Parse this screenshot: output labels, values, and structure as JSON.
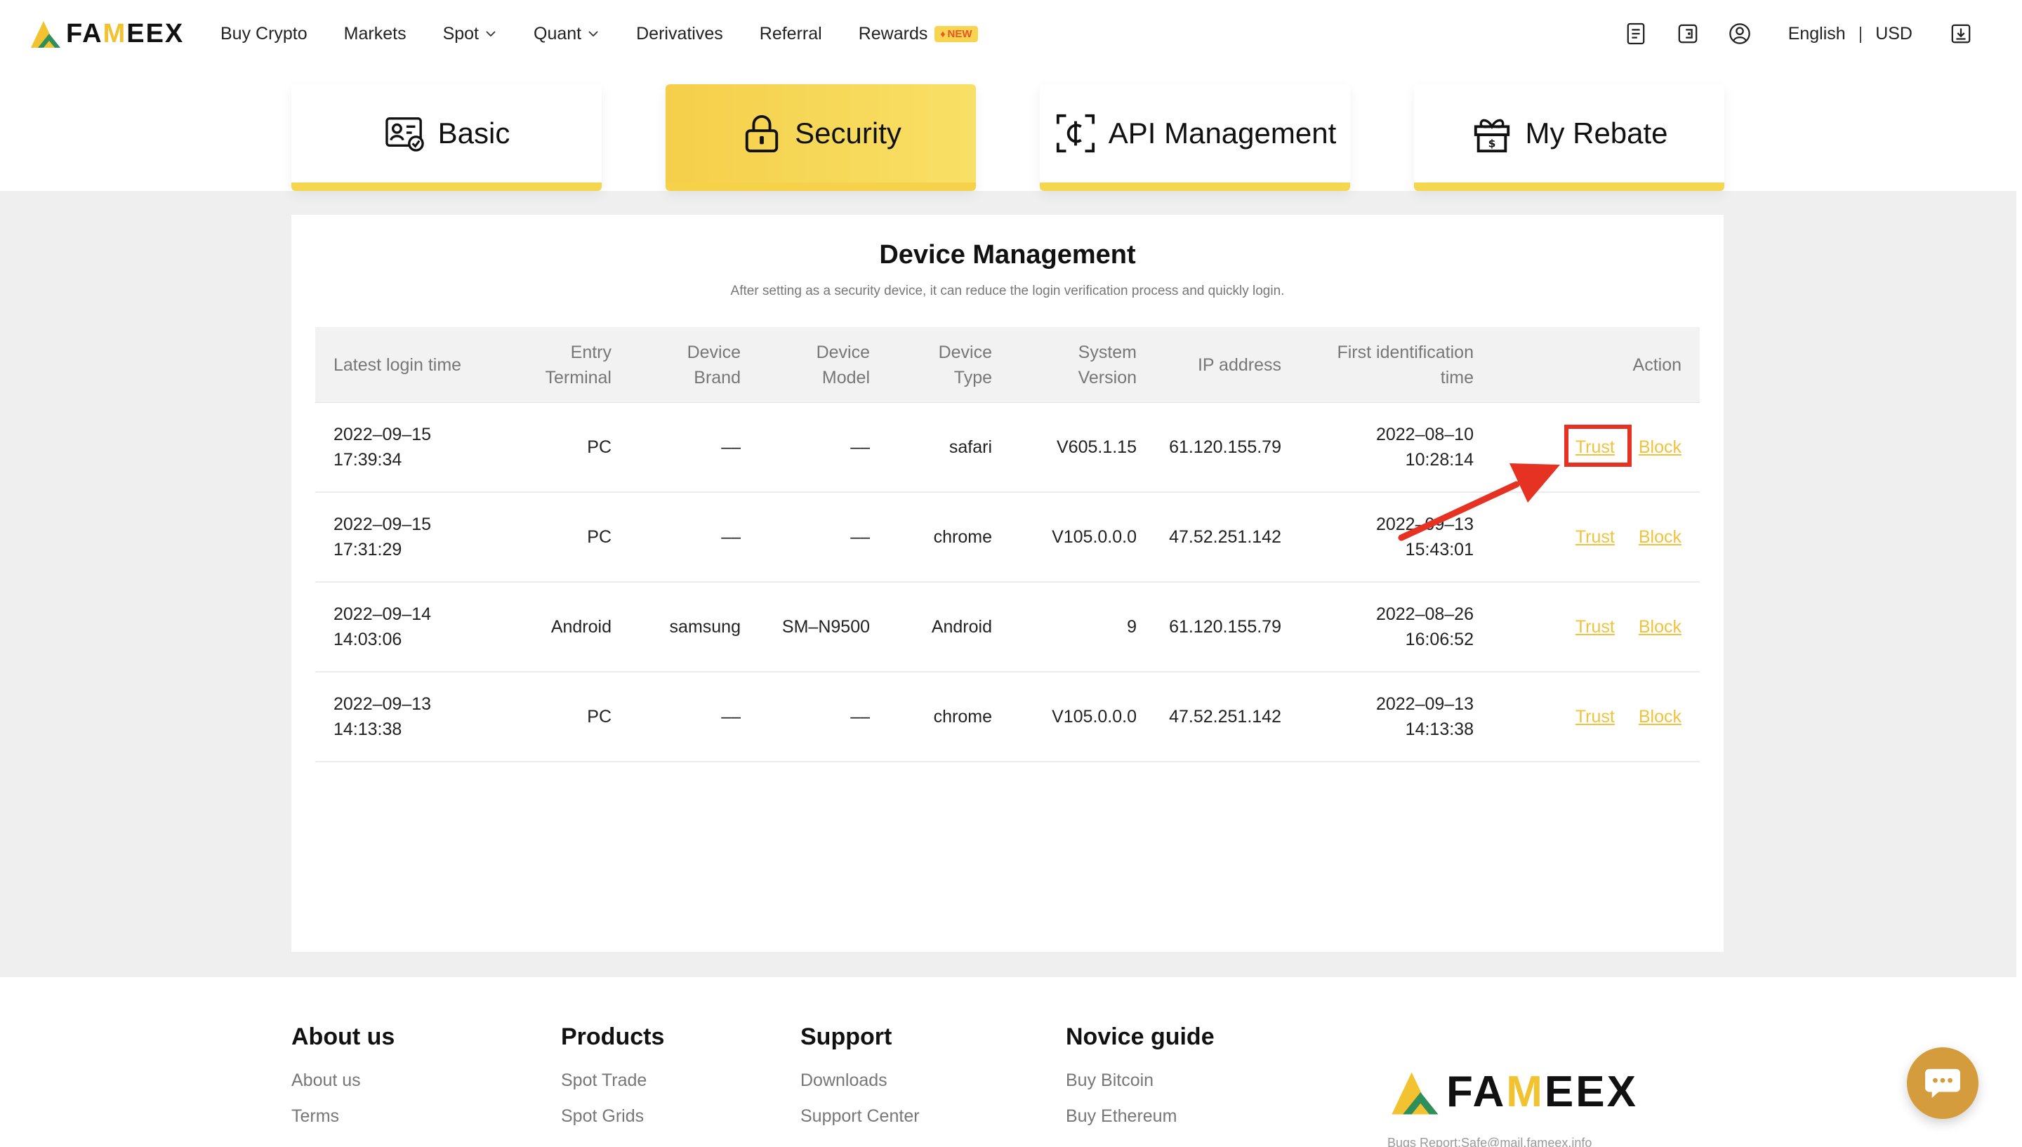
{
  "brand": {
    "name_pre": "FA",
    "name_m": "M",
    "name_post": "EEX"
  },
  "nav": {
    "items": [
      {
        "label": "Buy Crypto"
      },
      {
        "label": "Markets"
      },
      {
        "label": "Spot"
      },
      {
        "label": "Quant"
      },
      {
        "label": "Derivatives"
      },
      {
        "label": "Referral"
      },
      {
        "label": "Rewards"
      }
    ],
    "rewards_badge": "NEW",
    "language": "English",
    "separator": "|",
    "currency": "USD"
  },
  "tabs": [
    {
      "label": "Basic",
      "icon": "id-card-icon",
      "active": false
    },
    {
      "label": "Security",
      "icon": "lock-icon",
      "active": true
    },
    {
      "label": "API Management",
      "icon": "api-scan-icon",
      "active": false
    },
    {
      "label": "My Rebate",
      "icon": "gift-icon",
      "active": false
    }
  ],
  "device_management": {
    "title": "Device Management",
    "subtitle": "After setting as a security device, it can reduce the login verification process and quickly login.",
    "headers": {
      "latest_login": "Latest login time",
      "entry_1": "Entry",
      "entry_2": "Terminal",
      "brand_1": "Device",
      "brand_2": "Brand",
      "model_1": "Device",
      "model_2": "Model",
      "type_1": "Device",
      "type_2": "Type",
      "system_1": "System",
      "system_2": "Version",
      "ip": "IP address",
      "first_1": "First identification",
      "first_2": "time",
      "action": "Action"
    },
    "rows": [
      {
        "login_date": "2022–09–15",
        "login_time": "17:39:34",
        "entry": "PC",
        "brand": "––",
        "model": "––",
        "type": "safari",
        "system": "V605.1.15",
        "ip": "61.120.155.79",
        "first_date": "2022–08–10",
        "first_time": "10:28:14",
        "trust": "Trust",
        "block": "Block"
      },
      {
        "login_date": "2022–09–15",
        "login_time": "17:31:29",
        "entry": "PC",
        "brand": "––",
        "model": "––",
        "type": "chrome",
        "system": "V105.0.0.0",
        "ip": "47.52.251.142",
        "first_date": "2022–09–13",
        "first_time": "15:43:01",
        "trust": "Trust",
        "block": "Block"
      },
      {
        "login_date": "2022–09–14",
        "login_time": "14:03:06",
        "entry": "Android",
        "brand": "samsung",
        "model": "SM–N9500",
        "type": "Android",
        "system": "9",
        "ip": "61.120.155.79",
        "first_date": "2022–08–26",
        "first_time": "16:06:52",
        "trust": "Trust",
        "block": "Block"
      },
      {
        "login_date": "2022–09–13",
        "login_time": "14:13:38",
        "entry": "PC",
        "brand": "––",
        "model": "––",
        "type": "chrome",
        "system": "V105.0.0.0",
        "ip": "47.52.251.142",
        "first_date": "2022–09–13",
        "first_time": "14:13:38",
        "trust": "Trust",
        "block": "Block"
      }
    ]
  },
  "footer": {
    "about": {
      "title": "About us",
      "links": [
        "About us",
        "Terms"
      ]
    },
    "products": {
      "title": "Products",
      "links": [
        "Spot Trade",
        "Spot Grids"
      ]
    },
    "support": {
      "title": "Support",
      "links": [
        "Downloads",
        "Support Center"
      ]
    },
    "novice": {
      "title": "Novice guide",
      "links": [
        "Buy Bitcoin",
        "Buy Ethereum"
      ]
    },
    "bug_report": "Bugs Report:Safe@mail.fameex.info"
  },
  "colors": {
    "accent": "#f6d64f",
    "link": "#f0c23e",
    "highlight": "#e53222",
    "chat": "#d49c3d"
  }
}
